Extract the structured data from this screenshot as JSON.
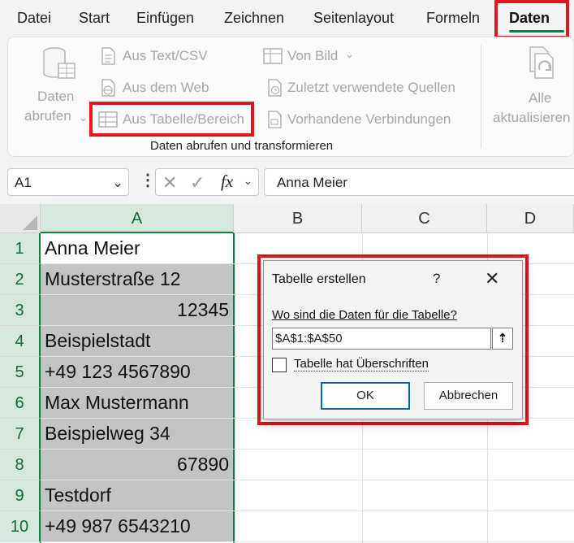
{
  "menu": {
    "tabs": [
      "Datei",
      "Start",
      "Einfügen",
      "Zeichnen",
      "Seitenlayout",
      "Formeln",
      "Daten"
    ],
    "active": "Daten"
  },
  "ribbon": {
    "get_data_line1": "Daten",
    "get_data_line2": "abrufen",
    "from_text_csv": "Aus Text/CSV",
    "from_web": "Aus dem Web",
    "from_table_range": "Aus Tabelle/Bereich",
    "from_picture": "Von Bild",
    "recent_sources": "Zuletzt verwendete Quellen",
    "existing_connections": "Vorhandene Verbindungen",
    "group_label": "Daten abrufen und transformieren",
    "refresh_all_line1": "Alle",
    "refresh_all_line2": "aktualisieren"
  },
  "formula_bar": {
    "name_box": "A1",
    "fx": "fx",
    "formula": "Anna Meier"
  },
  "sheet": {
    "columns": [
      "A",
      "B",
      "C",
      "D"
    ],
    "rows": [
      {
        "num": "1",
        "value": "Anna Meier",
        "numeric": false
      },
      {
        "num": "2",
        "value": "Musterstraße 12",
        "numeric": false
      },
      {
        "num": "3",
        "value": "12345",
        "numeric": true
      },
      {
        "num": "4",
        "value": "Beispielstadt",
        "numeric": false
      },
      {
        "num": "5",
        "value": "+49 123 4567890",
        "numeric": false
      },
      {
        "num": "6",
        "value": "Max Mustermann",
        "numeric": false
      },
      {
        "num": "7",
        "value": "Beispielweg 34",
        "numeric": false
      },
      {
        "num": "8",
        "value": "67890",
        "numeric": true
      },
      {
        "num": "9",
        "value": "Testdorf",
        "numeric": false
      },
      {
        "num": "10",
        "value": "+49 987 6543210",
        "numeric": false
      }
    ]
  },
  "dialog": {
    "title": "Tabelle erstellen",
    "help": "?",
    "question": "Wo sind die Daten für die Tabelle?",
    "range": "$A$1:$A$50",
    "headers_label": "Tabelle hat Überschriften",
    "headers_checked": false,
    "ok": "OK",
    "cancel": "Abbrechen"
  },
  "colors": {
    "accent": "#107c41",
    "highlight": "#e2141e",
    "selection_fill": "#c3c3c3",
    "ok_border": "#0067c0"
  }
}
